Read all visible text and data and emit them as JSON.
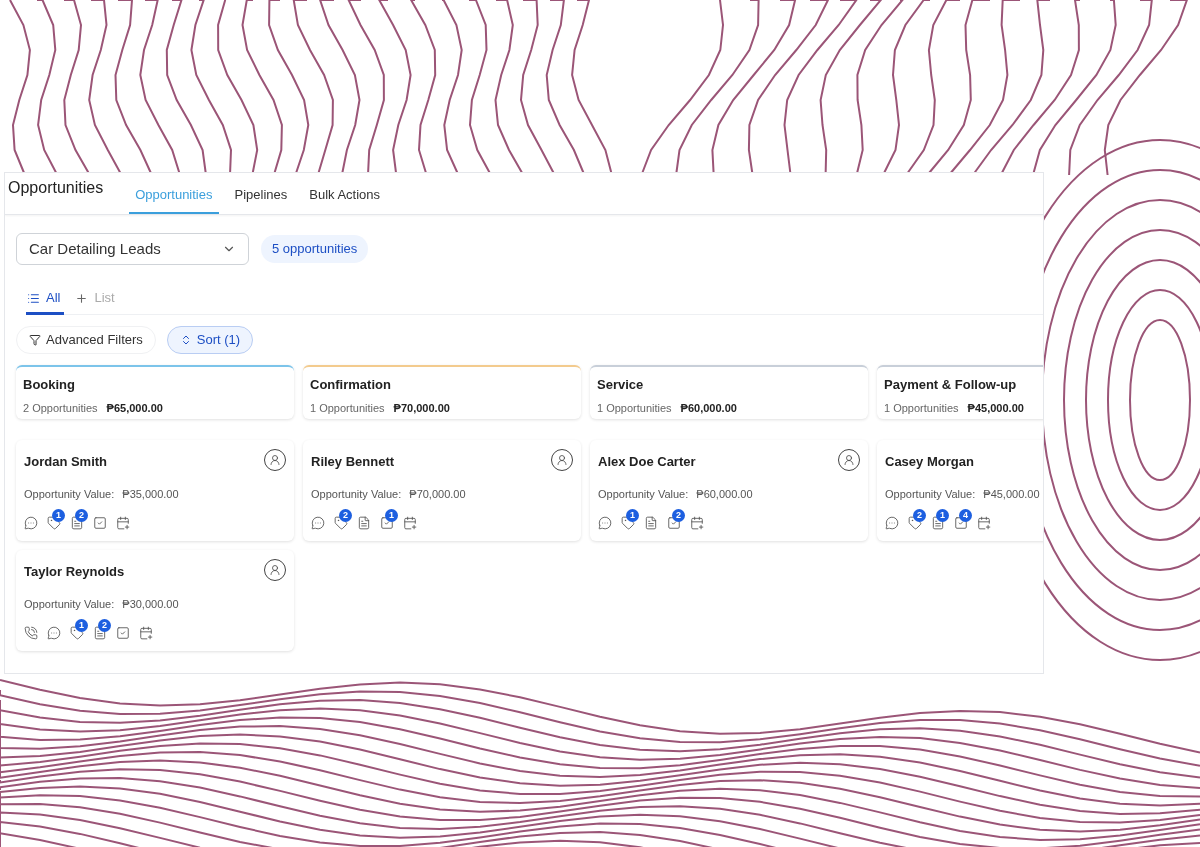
{
  "header": {
    "title": "Opportunities",
    "tabs": [
      {
        "label": "Opportunities",
        "selected": true
      },
      {
        "label": "Pipelines",
        "selected": false
      },
      {
        "label": "Bulk Actions",
        "selected": false
      }
    ]
  },
  "pipeline_select": {
    "value": "Car Detailing Leads"
  },
  "count_badge": "5 opportunities",
  "view_tabs": [
    {
      "label": "All",
      "kind": "list",
      "selected": true
    },
    {
      "label": "List",
      "kind": "add",
      "selected": false
    }
  ],
  "filters": [
    {
      "label": "Advanced Filters",
      "kind": "filter",
      "selected": false
    },
    {
      "label": "Sort (1)",
      "kind": "sort",
      "selected": true
    }
  ],
  "stages": [
    {
      "name": "Booking",
      "color": "#7cc4ea",
      "count": "2 Opportunities",
      "total": "₱65,000.00",
      "cards": [
        {
          "name": "Jordan Smith",
          "assign_button": true,
          "value_label": "Opportunity Value:",
          "value": "₱35,000.00",
          "icons": [
            {
              "kind": "chat"
            },
            {
              "kind": "tag",
              "badge": "1"
            },
            {
              "kind": "note",
              "badge": "2"
            },
            {
              "kind": "task"
            },
            {
              "kind": "calendar"
            }
          ]
        },
        {
          "name": "Taylor Reynolds",
          "assign_button": true,
          "value_label": "Opportunity Value:",
          "value": "₱30,000.00",
          "icons": [
            {
              "kind": "phone"
            },
            {
              "kind": "chat"
            },
            {
              "kind": "tag",
              "badge": "1"
            },
            {
              "kind": "note",
              "badge": "2"
            },
            {
              "kind": "task"
            },
            {
              "kind": "calendar"
            }
          ]
        }
      ]
    },
    {
      "name": "Confirmation",
      "color": "#f3cb8e",
      "count": "1 Opportunities",
      "total": "₱70,000.00",
      "cards": [
        {
          "name": "Riley Bennett",
          "assign_button": true,
          "value_label": "Opportunity Value:",
          "value": "₱70,000.00",
          "icons": [
            {
              "kind": "chat"
            },
            {
              "kind": "tag",
              "badge": "2"
            },
            {
              "kind": "note"
            },
            {
              "kind": "task",
              "badge": "1"
            },
            {
              "kind": "calendar"
            }
          ]
        }
      ]
    },
    {
      "name": "Service",
      "color": "#c8cfd9",
      "count": "1 Opportunities",
      "total": "₱60,000.00",
      "cards": [
        {
          "name": "Alex Doe Carter",
          "assign_button": true,
          "value_label": "Opportunity Value:",
          "value": "₱60,000.00",
          "icons": [
            {
              "kind": "chat"
            },
            {
              "kind": "tag",
              "badge": "1"
            },
            {
              "kind": "note"
            },
            {
              "kind": "task",
              "badge": "2"
            },
            {
              "kind": "calendar"
            }
          ]
        }
      ]
    },
    {
      "name": "Payment & Follow-up",
      "color": "#c8cfd9",
      "count": "1 Opportunities",
      "total": "₱45,000.00",
      "cards": [
        {
          "name": "Casey Morgan",
          "value_label": "Opportunity Value:",
          "value": "₱45,000.00",
          "icons": [
            {
              "kind": "chat"
            },
            {
              "kind": "tag",
              "badge": "2"
            },
            {
              "kind": "note",
              "badge": "1"
            },
            {
              "kind": "task",
              "badge": "4"
            },
            {
              "kind": "calendar"
            }
          ]
        }
      ]
    }
  ]
}
